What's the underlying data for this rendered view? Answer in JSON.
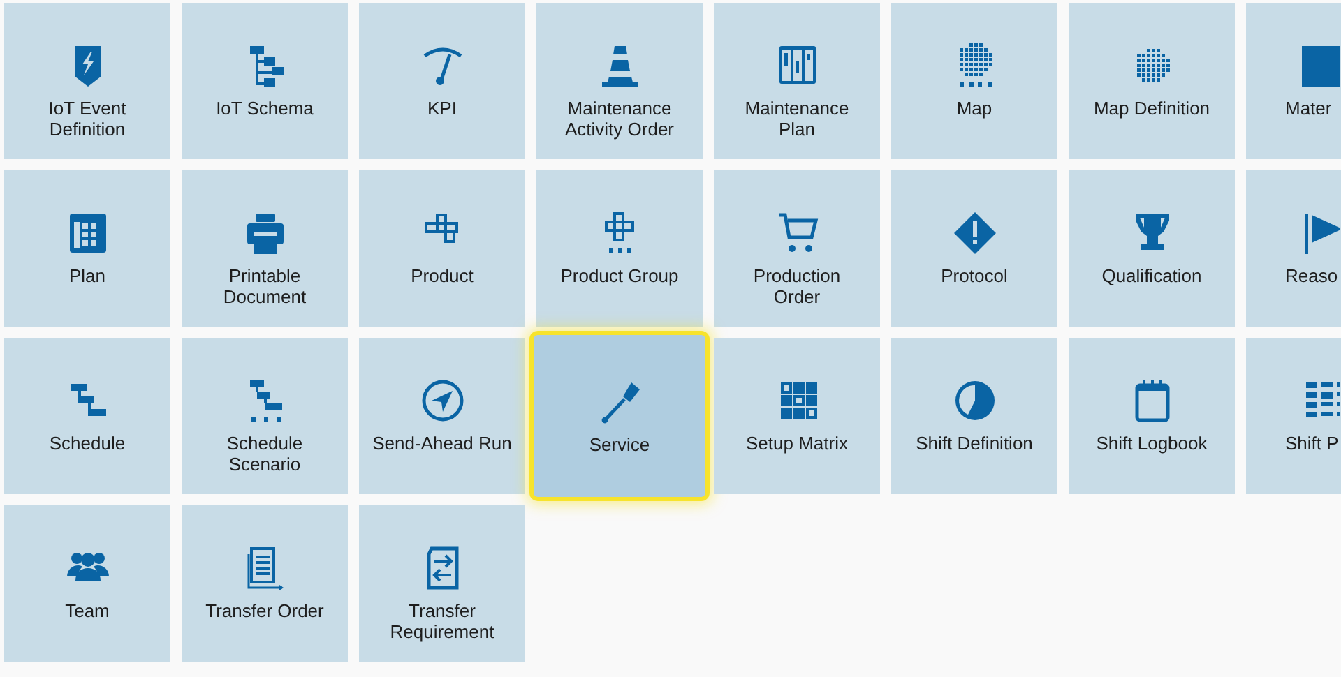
{
  "tiles": [
    {
      "label": "IoT Event\nDefinition",
      "selected": false
    },
    {
      "label": "IoT Schema",
      "selected": false
    },
    {
      "label": "KPI",
      "selected": false
    },
    {
      "label": "Maintenance\nActivity Order",
      "selected": false
    },
    {
      "label": "Maintenance\nPlan",
      "selected": false
    },
    {
      "label": "Map",
      "selected": false
    },
    {
      "label": "Map Definition",
      "selected": false
    },
    {
      "label": "Mater",
      "selected": false
    },
    {
      "label": "Plan",
      "selected": false
    },
    {
      "label": "Printable\nDocument",
      "selected": false
    },
    {
      "label": "Product",
      "selected": false
    },
    {
      "label": "Product Group",
      "selected": false
    },
    {
      "label": "Production\nOrder",
      "selected": false
    },
    {
      "label": "Protocol",
      "selected": false
    },
    {
      "label": "Qualification",
      "selected": false
    },
    {
      "label": "Reaso",
      "selected": false
    },
    {
      "label": "Schedule",
      "selected": false
    },
    {
      "label": "Schedule\nScenario",
      "selected": false
    },
    {
      "label": "Send-Ahead Run",
      "selected": false
    },
    {
      "label": "Service",
      "selected": true
    },
    {
      "label": "Setup Matrix",
      "selected": false
    },
    {
      "label": "Shift Definition",
      "selected": false
    },
    {
      "label": "Shift Logbook",
      "selected": false
    },
    {
      "label": "Shift P",
      "selected": false
    },
    {
      "label": "Team",
      "selected": false
    },
    {
      "label": "Transfer Order",
      "selected": false
    },
    {
      "label": "Transfer\nRequirement",
      "selected": false
    }
  ]
}
